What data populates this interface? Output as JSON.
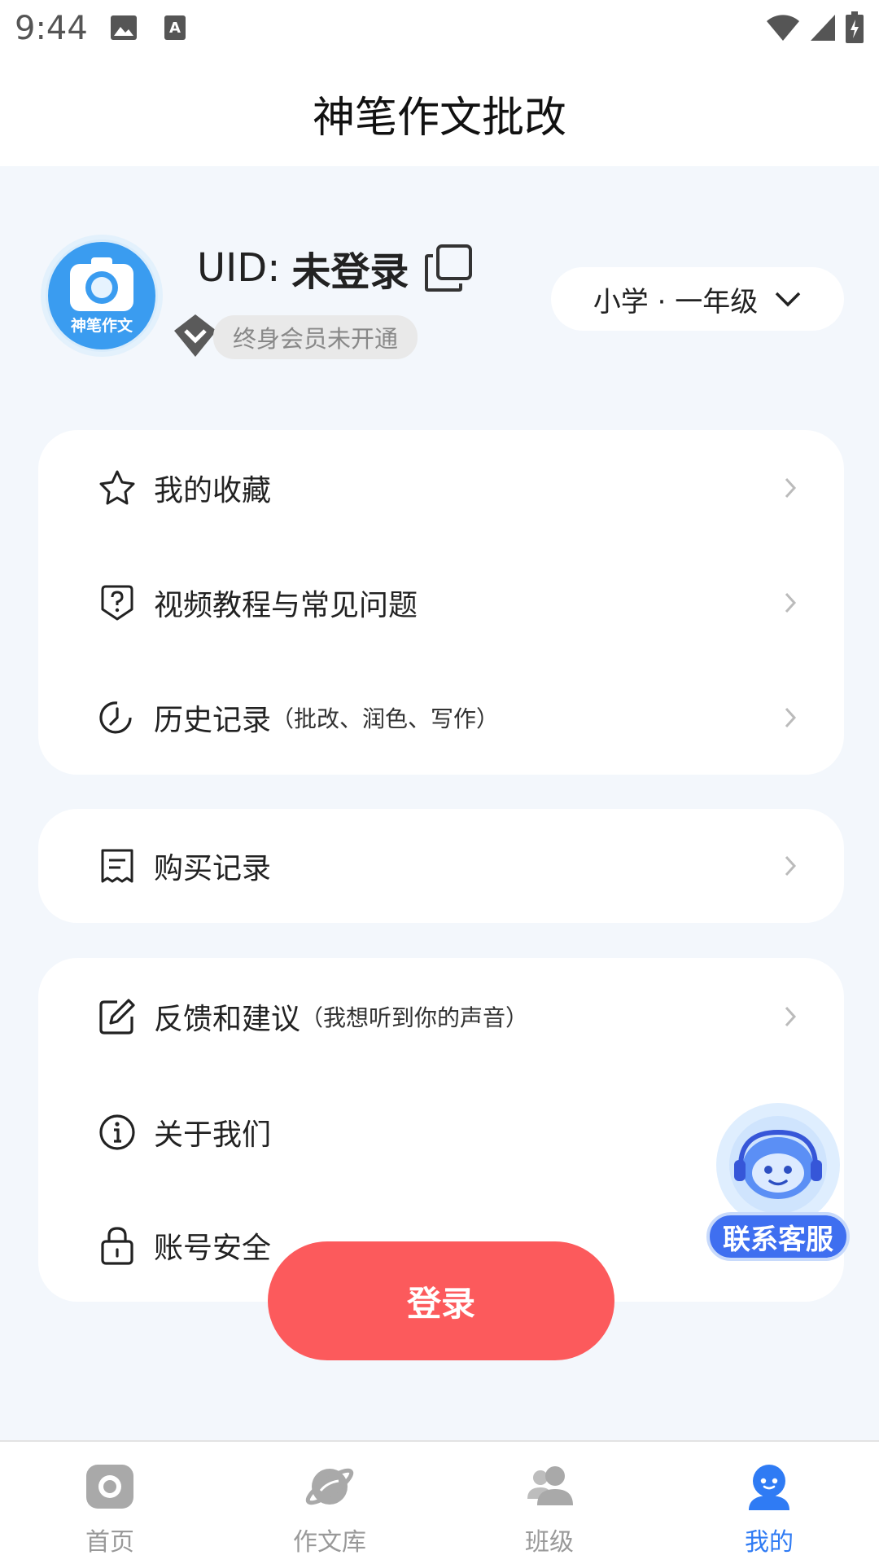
{
  "status_bar": {
    "time": "9:44"
  },
  "app_title": "神笔作文批改",
  "profile": {
    "avatar_text": "神笔作文",
    "uid_label": "UID:",
    "uid_value": "未登录",
    "vip_status": "终身会员未开通",
    "grade": "小学 · 一年级"
  },
  "menu_groups": [
    {
      "items": [
        {
          "label": "我的收藏",
          "hint": "",
          "icon": "star-icon"
        },
        {
          "label": "视频教程与常见问题",
          "hint": "",
          "icon": "question-shield-icon"
        },
        {
          "label": "历史记录",
          "hint": "（批改、润色、写作）",
          "icon": "history-clock-icon"
        }
      ]
    },
    {
      "items": [
        {
          "label": "购买记录",
          "hint": "",
          "icon": "receipt-icon"
        }
      ]
    },
    {
      "items": [
        {
          "label": "反馈和建议",
          "hint": "（我想听到你的声音）",
          "icon": "edit-icon"
        },
        {
          "label": "关于我们",
          "hint": "",
          "icon": "info-icon"
        },
        {
          "label": "账号安全",
          "hint": "",
          "icon": "lock-icon"
        }
      ]
    }
  ],
  "customer_service": {
    "label": "联系客服"
  },
  "login_button": "登录",
  "tabs": [
    {
      "label": "首页",
      "icon": "home-camera-icon",
      "active": false
    },
    {
      "label": "作文库",
      "icon": "planet-icon",
      "active": false
    },
    {
      "label": "班级",
      "icon": "class-people-icon",
      "active": false
    },
    {
      "label": "我的",
      "icon": "profile-robot-icon",
      "active": true
    }
  ],
  "colors": {
    "accent": "#2f7bf4",
    "login": "#fc5a5c",
    "background": "#f3f7fc"
  }
}
